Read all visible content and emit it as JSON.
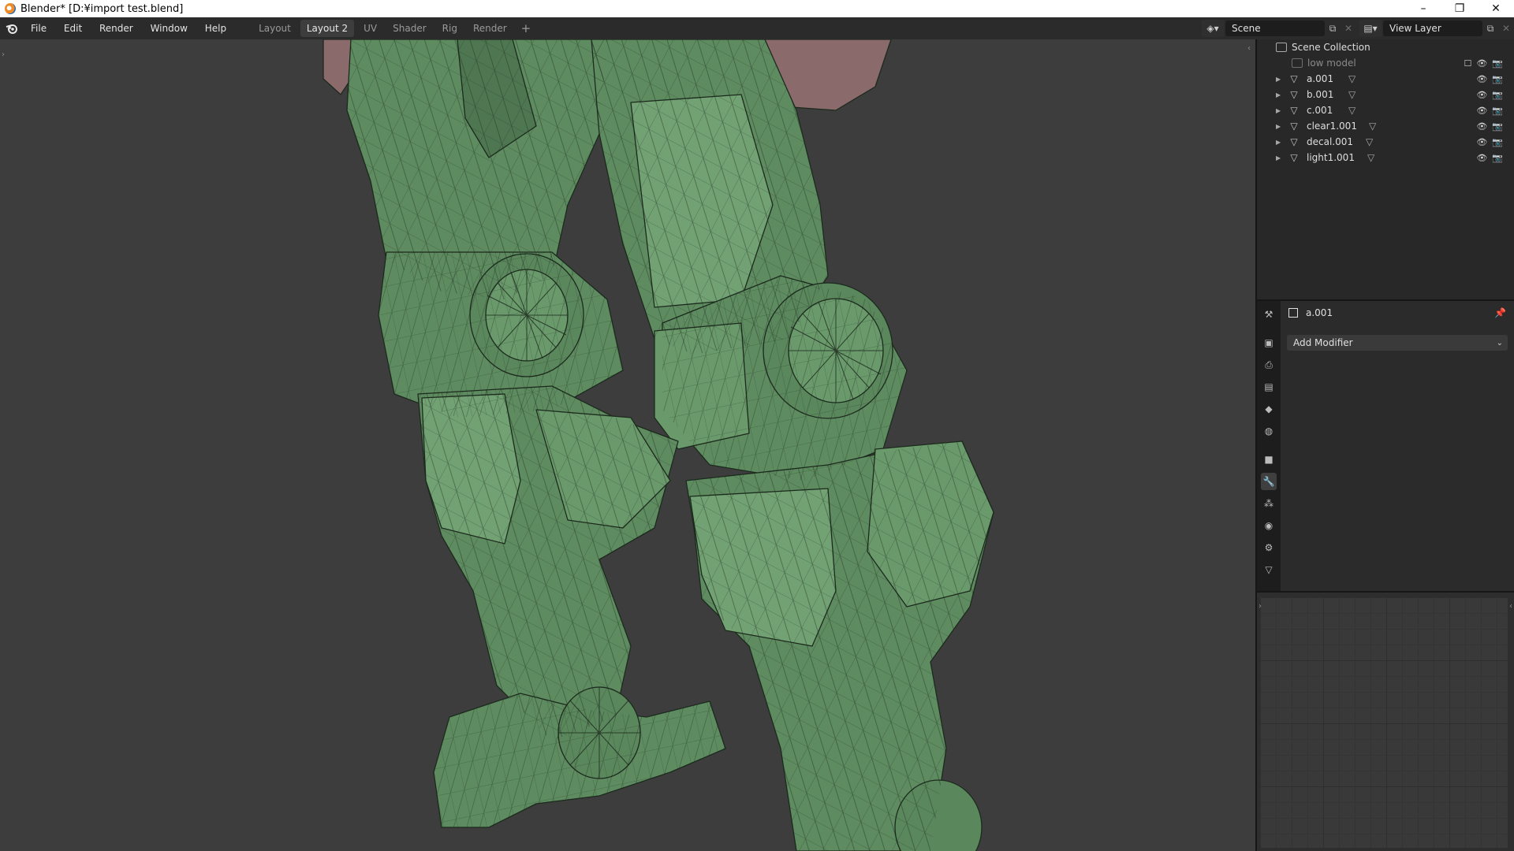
{
  "window": {
    "title": "Blender* [D:¥import test.blend]",
    "controls": {
      "minimize": "–",
      "maximize": "❐",
      "close": "✕"
    }
  },
  "menu": [
    "File",
    "Edit",
    "Render",
    "Window",
    "Help"
  ],
  "workspaces": {
    "tabs": [
      "Layout",
      "Layout 2",
      "UV",
      "Shader",
      "Rig",
      "Render"
    ],
    "active": "Layout 2",
    "add": "+"
  },
  "scene": {
    "name": "Scene",
    "view_layer": "View Layer"
  },
  "outliner": {
    "root": "Scene Collection",
    "collection": "low model",
    "objects": [
      {
        "name": "a.001"
      },
      {
        "name": "b.001"
      },
      {
        "name": "c.001"
      },
      {
        "name": "clear1.001"
      },
      {
        "name": "decal.001"
      },
      {
        "name": "light1.001"
      }
    ]
  },
  "properties": {
    "object_name": "a.001",
    "add_modifier": "Add Modifier",
    "active_tab": "modifier-tab"
  },
  "colors": {
    "viewport_bg": "#3d3d3d",
    "mesh_fill": "#5e8c60",
    "mesh_fill_light": "#72a273",
    "mesh_fill_dark": "#4e7751",
    "wire": "#1c2a1d",
    "hand_fill": "#8a6a6a"
  }
}
